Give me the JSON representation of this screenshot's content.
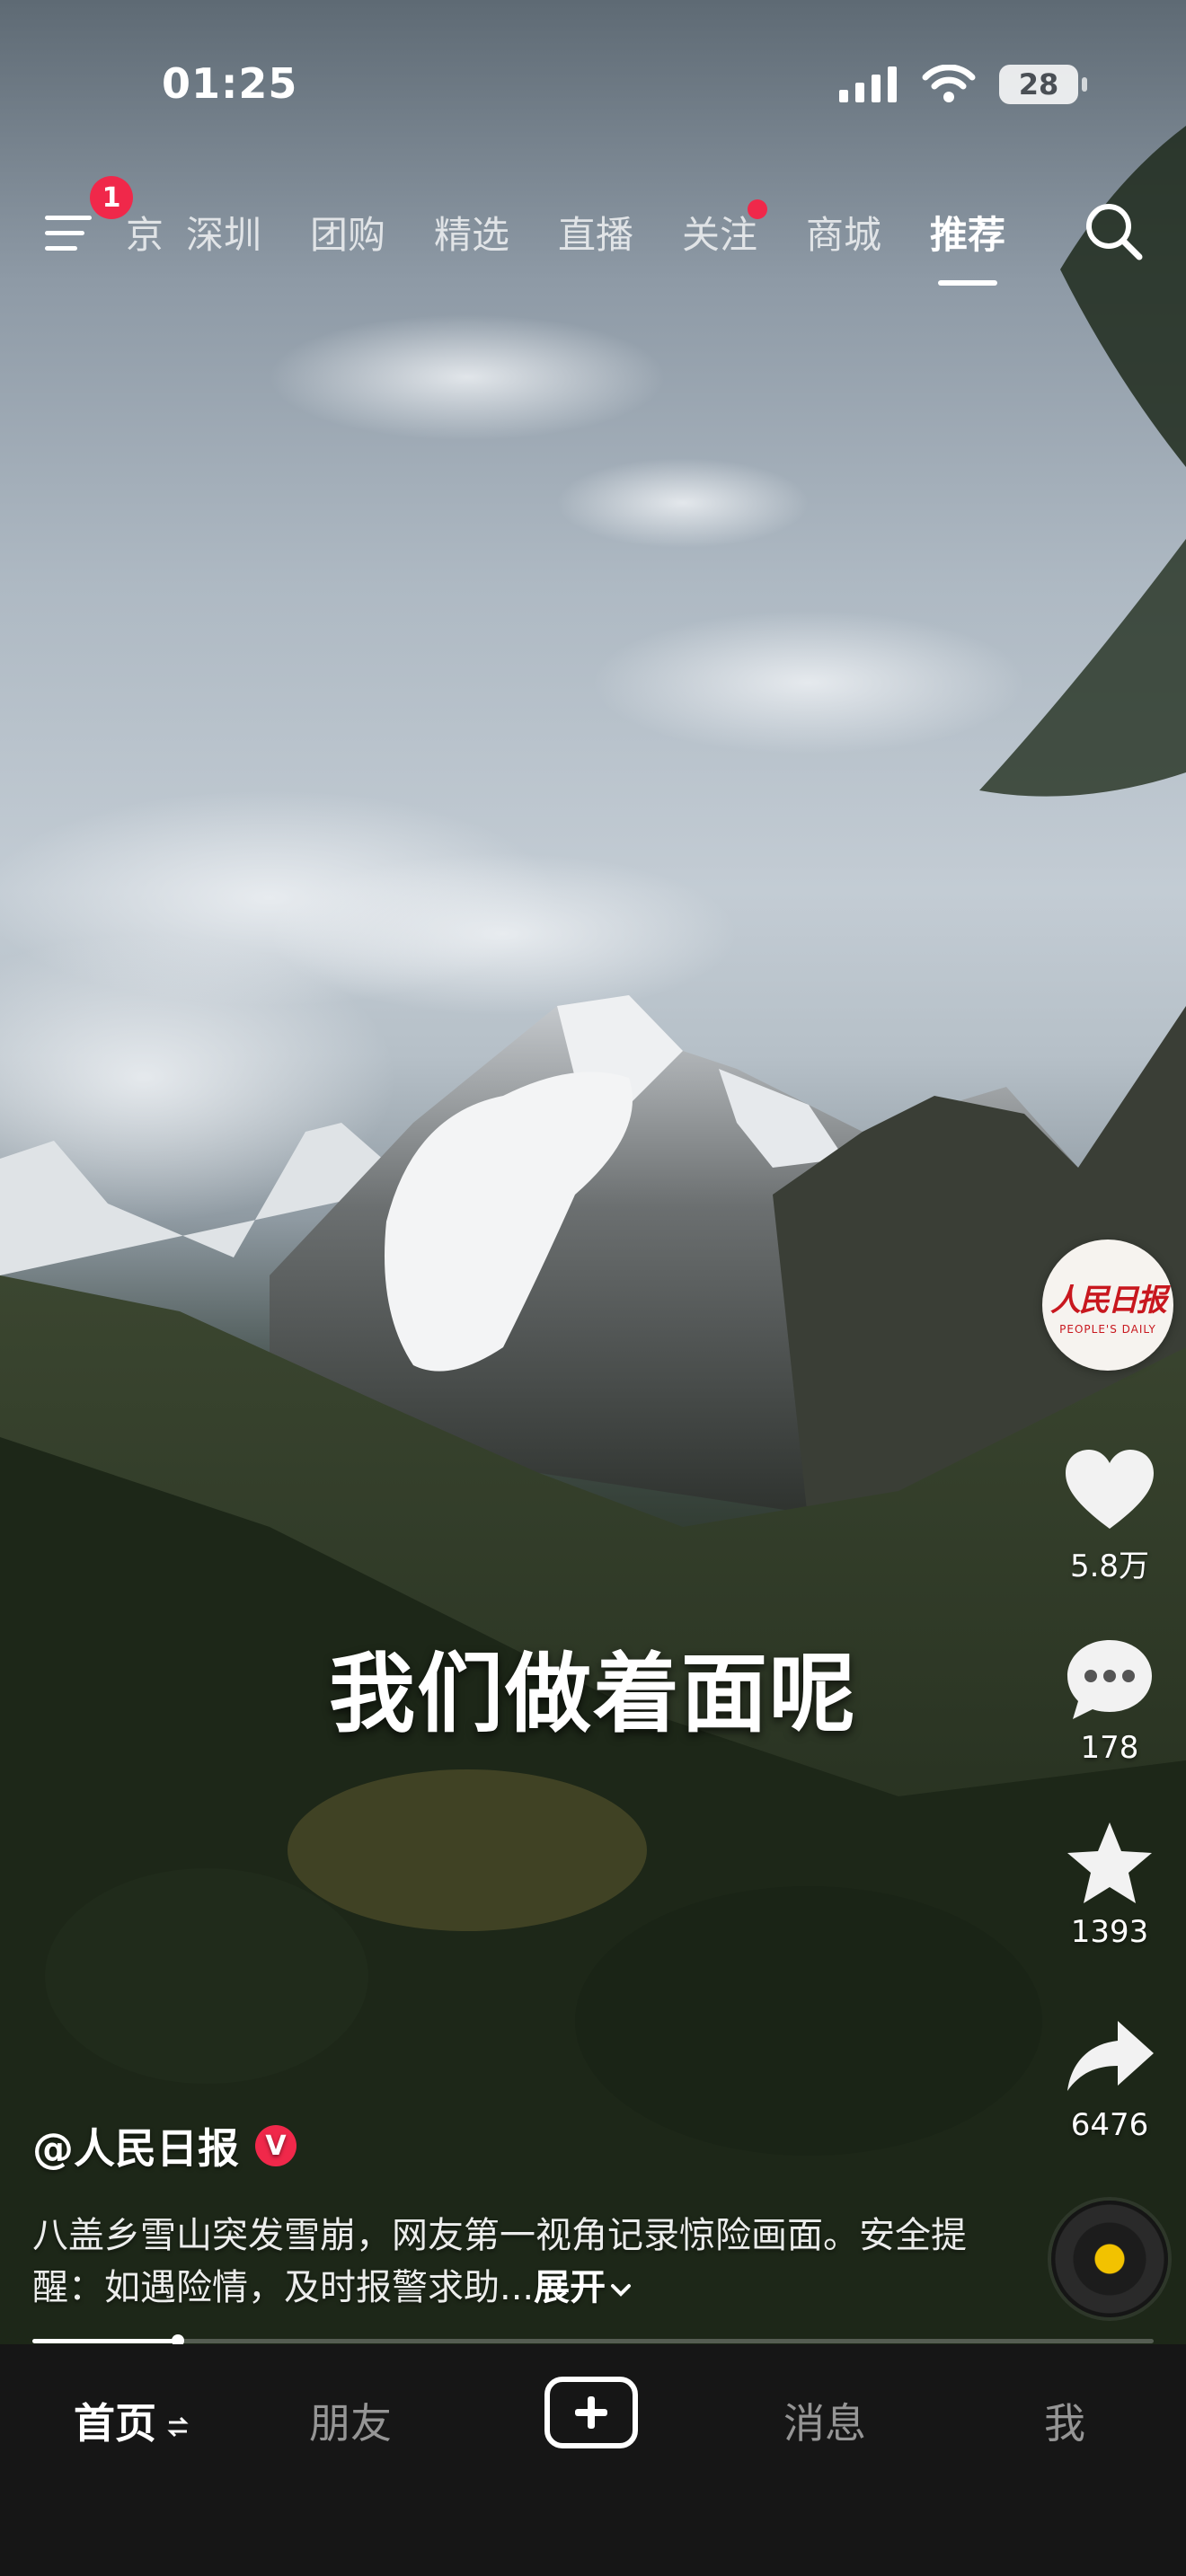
{
  "status_bar": {
    "time": "01:25",
    "battery": "28"
  },
  "top_nav": {
    "menu_badge": "1",
    "tabs": [
      {
        "label": "京",
        "partial": true
      },
      {
        "label": "深圳"
      },
      {
        "label": "团购"
      },
      {
        "label": "精选"
      },
      {
        "label": "直播"
      },
      {
        "label": "关注",
        "dot": true
      },
      {
        "label": "商城"
      },
      {
        "label": "推荐",
        "active": true
      }
    ]
  },
  "video": {
    "subtitle": "我们做着面呢"
  },
  "creator": {
    "avatar_text": "人民日报",
    "avatar_subtext": "PEOPLE'S DAILY",
    "handle": "@人民日报",
    "verified_mark": "V"
  },
  "actions": {
    "likes": "5.8万",
    "comments": "178",
    "favorites": "1393",
    "shares": "6476"
  },
  "description": {
    "text": "八盖乡雪山突发雪崩，网友第一视角记录惊险画面。安全提醒：如遇险情，及时报警求助...",
    "expand_label": "展开"
  },
  "playback": {
    "progress": 0.13
  },
  "bottom_nav": {
    "home": "首页",
    "friends": "朋友",
    "messages": "消息",
    "me": "我"
  },
  "colors": {
    "accent_red": "#f0284a",
    "nav_bg": "#161616"
  }
}
